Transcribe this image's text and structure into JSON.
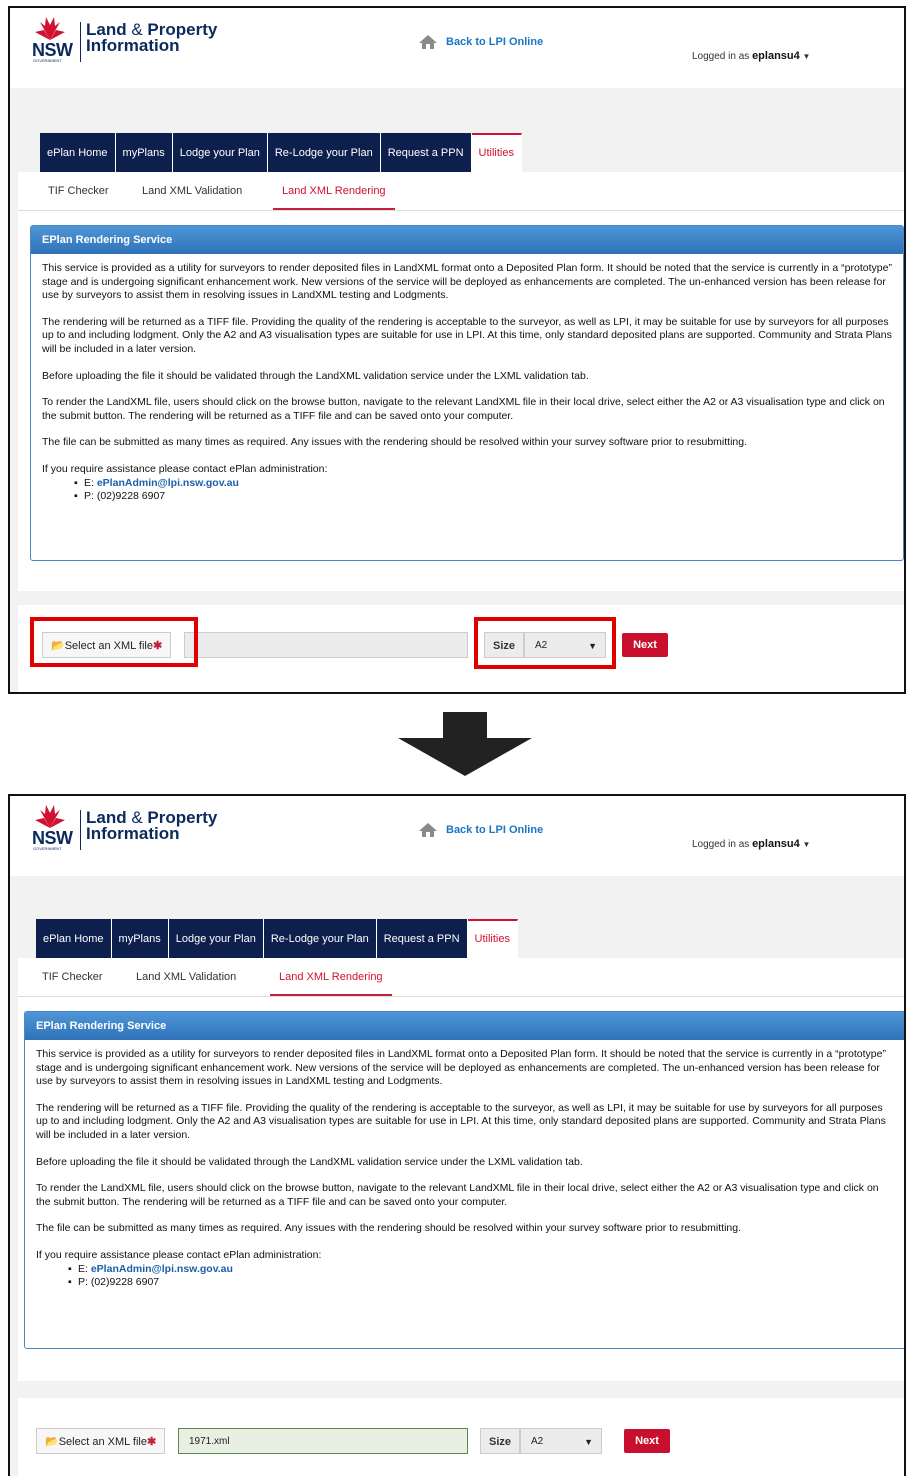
{
  "header": {
    "logo_nsw": "NSW",
    "logo_gov": "GOVERNMENT",
    "logo_line1_a": "Land",
    "logo_line1_amp": " & ",
    "logo_line1_b": "Property",
    "logo_line2": "Information",
    "back_link": "Back to LPI Online",
    "logged_in_prefix": "Logged in as",
    "username": "eplansu4"
  },
  "nav_tabs": [
    "ePlan Home",
    "myPlans",
    "Lodge your Plan",
    "Re-Lodge your Plan",
    "Request a PPN",
    "Utilities"
  ],
  "sub_tabs": [
    "TIF Checker",
    "Land XML Validation",
    "Land XML Rendering"
  ],
  "panel": {
    "title": "EPlan Rendering Service",
    "p1": "This service is provided as a utility for surveyors to render deposited files in LandXML format onto a Deposited Plan form. It should be noted that the service is currently in a “prototype” stage and is undergoing significant enhancement work. New versions of the service will be deployed as enhancements are completed. The un-enhanced version has been release for use by surveyors to assist them in resolving issues in LandXML testing and Lodgments.",
    "p2": "The rendering will be returned as a TIFF file. Providing the quality of the rendering is acceptable to the surveyor, as well as LPI, it may be suitable for use by surveyors for all purposes up to and including lodgment. Only the A2 and A3 visualisation types are suitable for use in LPI. At this time, only standard deposited plans are supported. Community and Strata Plans will be included in a later version.",
    "p3": "Before uploading the file it should be validated through the LandXML validation service under the LXML validation tab.",
    "p4": "To render the LandXML file, users should click on the browse button, navigate to the relevant LandXML file in their local drive, select either the A2 or A3 visualisation type and click on the submit button. The rendering will be returned as a TIFF file and can be saved onto your computer.",
    "p5": "The file can be submitted as many times as required. Any issues with the rendering should be resolved within your survey software prior to resubmitting.",
    "p6": "If you require assistance please contact ePlan administration:",
    "email_prefix": "E: ",
    "email": "ePlanAdmin@lpi.nsw.gov.au",
    "phone": "P: (02)9228 6907"
  },
  "form": {
    "file_button": "Select an XML file",
    "required_mark": "✱",
    "size_label": "Size",
    "size_value": "A2",
    "next_button": "Next",
    "before_file_value": "",
    "after_file_value": "1971.xml"
  },
  "colors": {
    "nav_bg": "#0d1f4d",
    "accent_red": "#c8102e",
    "panel_blue": "#2f72b8",
    "highlight": "#e00000"
  }
}
